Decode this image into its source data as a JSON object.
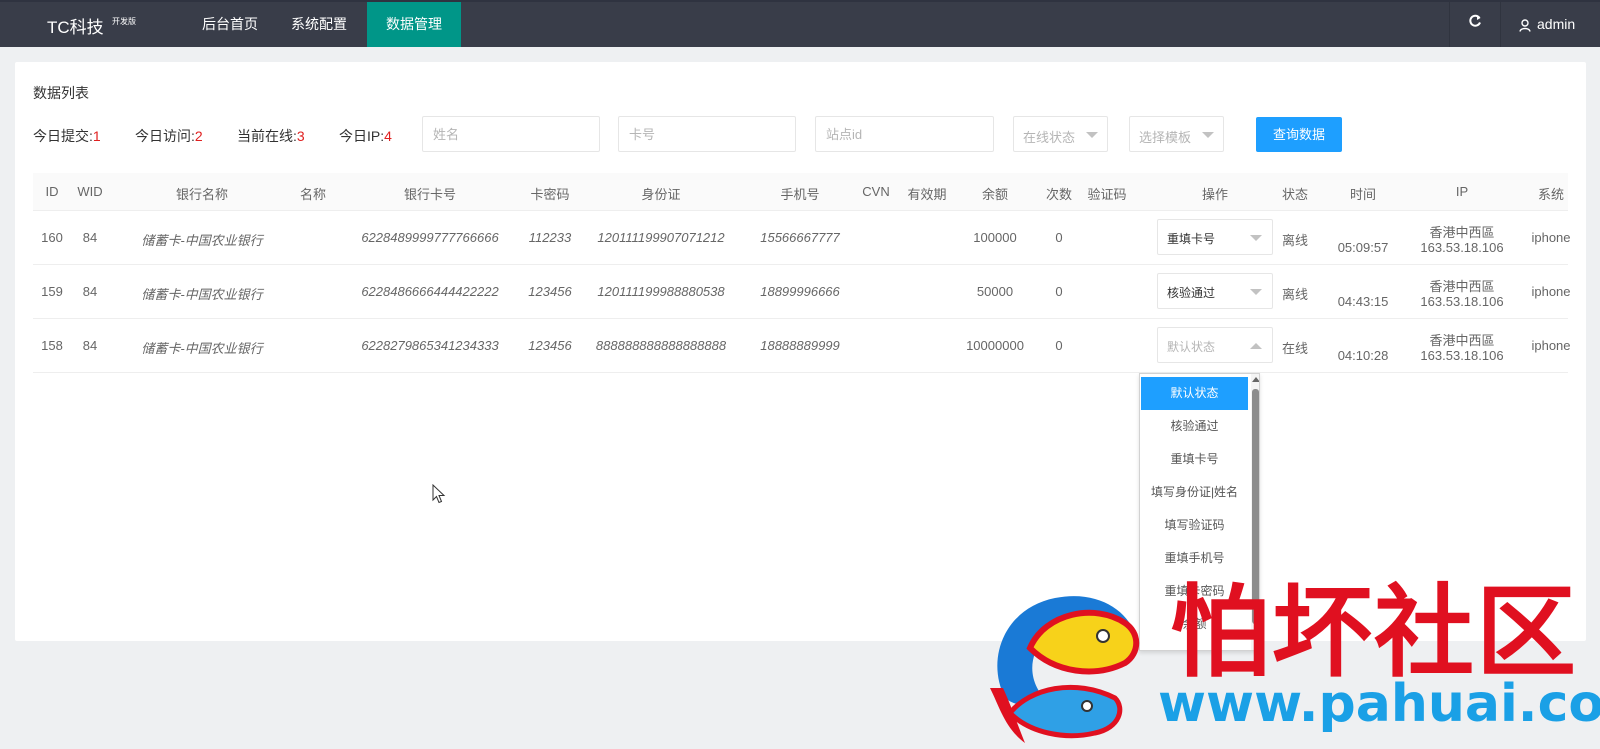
{
  "nav": {
    "brand": "TC科技",
    "brand_sup": "开发版",
    "items": [
      "后台首页",
      "系统配置",
      "数据管理"
    ],
    "active": "数据管理",
    "user": "admin"
  },
  "panel": {
    "title": "数据列表",
    "stats": [
      {
        "label": "今日提交:",
        "value": "1"
      },
      {
        "label": "今日访问:",
        "value": "2"
      },
      {
        "label": "当前在线:",
        "value": "3"
      },
      {
        "label": "今日IP:",
        "value": "4"
      }
    ],
    "filters": {
      "name_placeholder": "姓名",
      "card_placeholder": "卡号",
      "site_placeholder": "站点id",
      "status_placeholder": "在线状态",
      "template_placeholder": "选择模板",
      "query_label": "查询数据"
    }
  },
  "table": {
    "headers": [
      "ID",
      "WID",
      "银行名称",
      "名称",
      "银行卡号",
      "卡密码",
      "身份证",
      "手机号",
      "CVN",
      "有效期",
      "余额",
      "次数",
      "验证码",
      "操作",
      "状态",
      "时间",
      "IP",
      "系统"
    ],
    "rows": [
      {
        "id": "160",
        "wid": "84",
        "bank": "储蓄卡-中国农业银行",
        "name": "",
        "card": "6228489999777766666",
        "pwd": "112233",
        "idcard": "120111199907071212",
        "phone": "15566667777",
        "cvn": "",
        "expiry": "",
        "balance": "100000",
        "count": "0",
        "code": "",
        "op": "重填卡号",
        "status": "离线",
        "time": "05:09:57",
        "ip_loc": "香港中西區",
        "ip": "163.53.18.106",
        "system": "iphone"
      },
      {
        "id": "159",
        "wid": "84",
        "bank": "储蓄卡-中国农业银行",
        "name": "",
        "card": "6228486666444422222",
        "pwd": "123456",
        "idcard": "120111199988880538",
        "phone": "18899996666",
        "cvn": "",
        "expiry": "",
        "balance": "50000",
        "count": "0",
        "code": "",
        "op": "核验通过",
        "status": "离线",
        "time": "04:43:15",
        "ip_loc": "香港中西區",
        "ip": "163.53.18.106",
        "system": "iphone"
      },
      {
        "id": "158",
        "wid": "84",
        "bank": "储蓄卡-中国农业银行",
        "name": "",
        "card": "6228279865341234333",
        "pwd": "123456",
        "idcard": "888888888888888888",
        "phone": "18888889999",
        "cvn": "",
        "expiry": "",
        "balance": "10000000",
        "count": "0",
        "code": "",
        "op": "默认状态",
        "status": "在线",
        "time": "04:10:28",
        "ip_loc": "香港中西區",
        "ip": "163.53.18.106",
        "system": "iphone"
      }
    ]
  },
  "dropdown": {
    "options": [
      "默认状态",
      "核验通过",
      "重填卡号",
      "填写身份证|姓名",
      "填写验证码",
      "重填手机号",
      "重填卡密码",
      "余额"
    ],
    "selected": "默认状态"
  },
  "watermark": {
    "title": "怕坏社区",
    "url": "www.pahuai.com"
  },
  "colors": {
    "nav_bg": "#393d49",
    "nav_active": "#009688",
    "button": "#1e9fff",
    "stat_number": "#e02020"
  }
}
